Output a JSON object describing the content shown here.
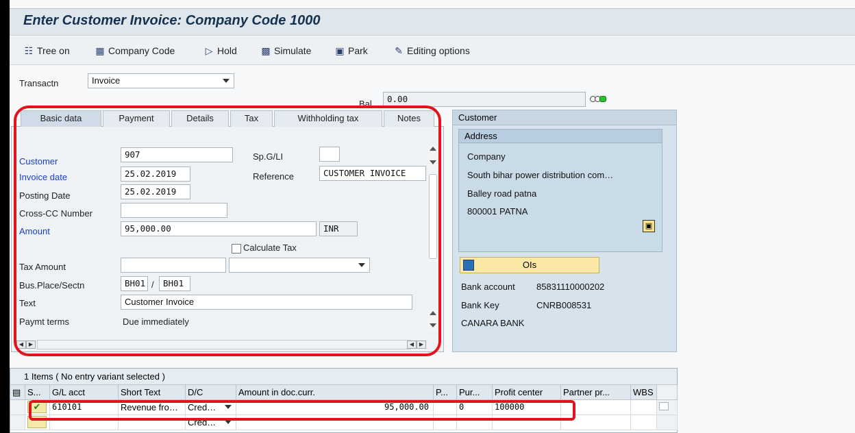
{
  "title": "Enter Customer Invoice: Company Code 1000",
  "toolbar": {
    "tree_on": "Tree on",
    "company_code": "Company Code",
    "hold": "Hold",
    "simulate": "Simulate",
    "park": "Park",
    "editing_options": "Editing options"
  },
  "transaction": {
    "label": "Transactn",
    "value": "Invoice"
  },
  "balance": {
    "label": "Bal.",
    "value": "0.00"
  },
  "tabs": [
    "Basic data",
    "Payment",
    "Details",
    "Tax",
    "Withholding tax",
    "Notes"
  ],
  "basic": {
    "customer_label": "Customer",
    "customer_value": "907",
    "spgl_label": "Sp.G/LI",
    "spgl_value": "",
    "invoice_date_label": "Invoice date",
    "invoice_date_value": "25.02.2019",
    "reference_label": "Reference",
    "reference_value": "CUSTOMER INVOICE",
    "posting_date_label": "Posting Date",
    "posting_date_value": "25.02.2019",
    "crosscc_label": "Cross-CC Number",
    "crosscc_value": "",
    "amount_label": "Amount",
    "amount_value": "95,000.00",
    "currency": "INR",
    "calc_tax_label": "Calculate Tax",
    "tax_amount_label": "Tax Amount",
    "tax_amount_value": "",
    "bus_place_label": "Bus.Place/Sectn",
    "bus_place_value": "BH01",
    "sep": "/",
    "section_value": "BH01",
    "text_label": "Text",
    "text_value": "Customer Invoice",
    "paymt_terms_label": "Paymt terms",
    "paymt_terms_value": "Due immediately"
  },
  "customer_panel": {
    "title": "Customer",
    "address_title": "Address",
    "address_lines": [
      "Company",
      "South bihar power distribution com…",
      "Balley road patna",
      "800001 PATNA"
    ],
    "ois_label": "OIs",
    "bank_account_label": "Bank account",
    "bank_account_value": "85831110000202",
    "bank_key_label": "Bank Key",
    "bank_key_value": "CNRB008531",
    "bank_name": "CANARA BANK"
  },
  "items": {
    "title": "1 Items ( No entry variant selected )",
    "columns": [
      "S...",
      "G/L acct",
      "Short Text",
      "D/C",
      "Amount in doc.curr.",
      "P...",
      "Pur...",
      "Profit center",
      "Partner pr...",
      "WBS"
    ],
    "rows": [
      {
        "gl": "610101",
        "short_text": "Revenue fro…",
        "dc": "Cred…",
        "amount": "95,000.00",
        "pur": "0",
        "profit_center": "100000"
      },
      {
        "gl": "",
        "short_text": "",
        "dc": "Cred…",
        "amount": "",
        "pur": "",
        "profit_center": ""
      }
    ]
  },
  "colors": {
    "highlight": "#e1141e",
    "title_text": "#15324f",
    "blue_label": "#1a3fc4"
  }
}
